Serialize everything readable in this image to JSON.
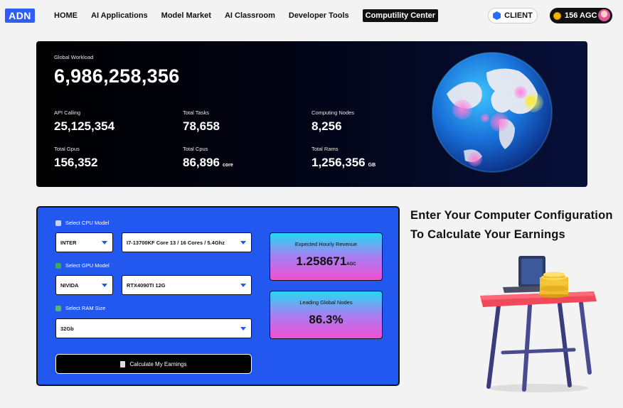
{
  "header": {
    "logo": "ADN",
    "nav": [
      "HOME",
      "AI Applications",
      "Model Market",
      "AI Classroom",
      "Developer Tools",
      "Computility Center"
    ],
    "active_nav": "Computility Center",
    "client_label": "CLIENT",
    "balance_label": "156 AGC"
  },
  "stats": {
    "global_workload_label": "Global Workload",
    "global_workload_value": "6,986,258,356",
    "items": [
      {
        "label": "API Calling",
        "value": "25,125,354",
        "unit": ""
      },
      {
        "label": "Total Tasks",
        "value": "78,658",
        "unit": ""
      },
      {
        "label": "Computing Nodes",
        "value": "8,256",
        "unit": ""
      },
      {
        "label": "Total Gpus",
        "value": "156,352",
        "unit": ""
      },
      {
        "label": "Total Cpus",
        "value": "86,896",
        "unit": "core"
      },
      {
        "label": "Total Rams",
        "value": "1,256,356",
        "unit": "GB"
      }
    ]
  },
  "calculator": {
    "cpu_label": "Select CPU Model",
    "cpu_brand": "INTER",
    "cpu_model": "I7-13700KF Core 13 / 16 Cores / 5.4Ghz",
    "gpu_label": "Select GPU Model",
    "gpu_brand": "NIVIDA",
    "gpu_model": "RTX4090TI 12G",
    "ram_label": "Select RAM Size",
    "ram_size": "32Gb",
    "button_label": "Calculate My Earnings",
    "revenue_title": "Expected Hourly Revenue",
    "revenue_value": "1.258671",
    "revenue_unit": "AGC",
    "nodes_title": "Leading Global Nodes",
    "nodes_value": "86.3%"
  },
  "headline": "Enter Your Computer Configuration To Calculate Your Earnings",
  "colors": {
    "accent_blue": "#2358f0",
    "panel_dark": "#000000",
    "card_gradient_top": "#25d8f2",
    "card_gradient_bottom": "#f14fd2",
    "coin": "#f4b400"
  },
  "icons": [
    "client-hex-icon",
    "coin-icon",
    "cpu-icon",
    "gpu-icon",
    "ram-icon",
    "calculator-icon",
    "chevron-down-icon"
  ]
}
